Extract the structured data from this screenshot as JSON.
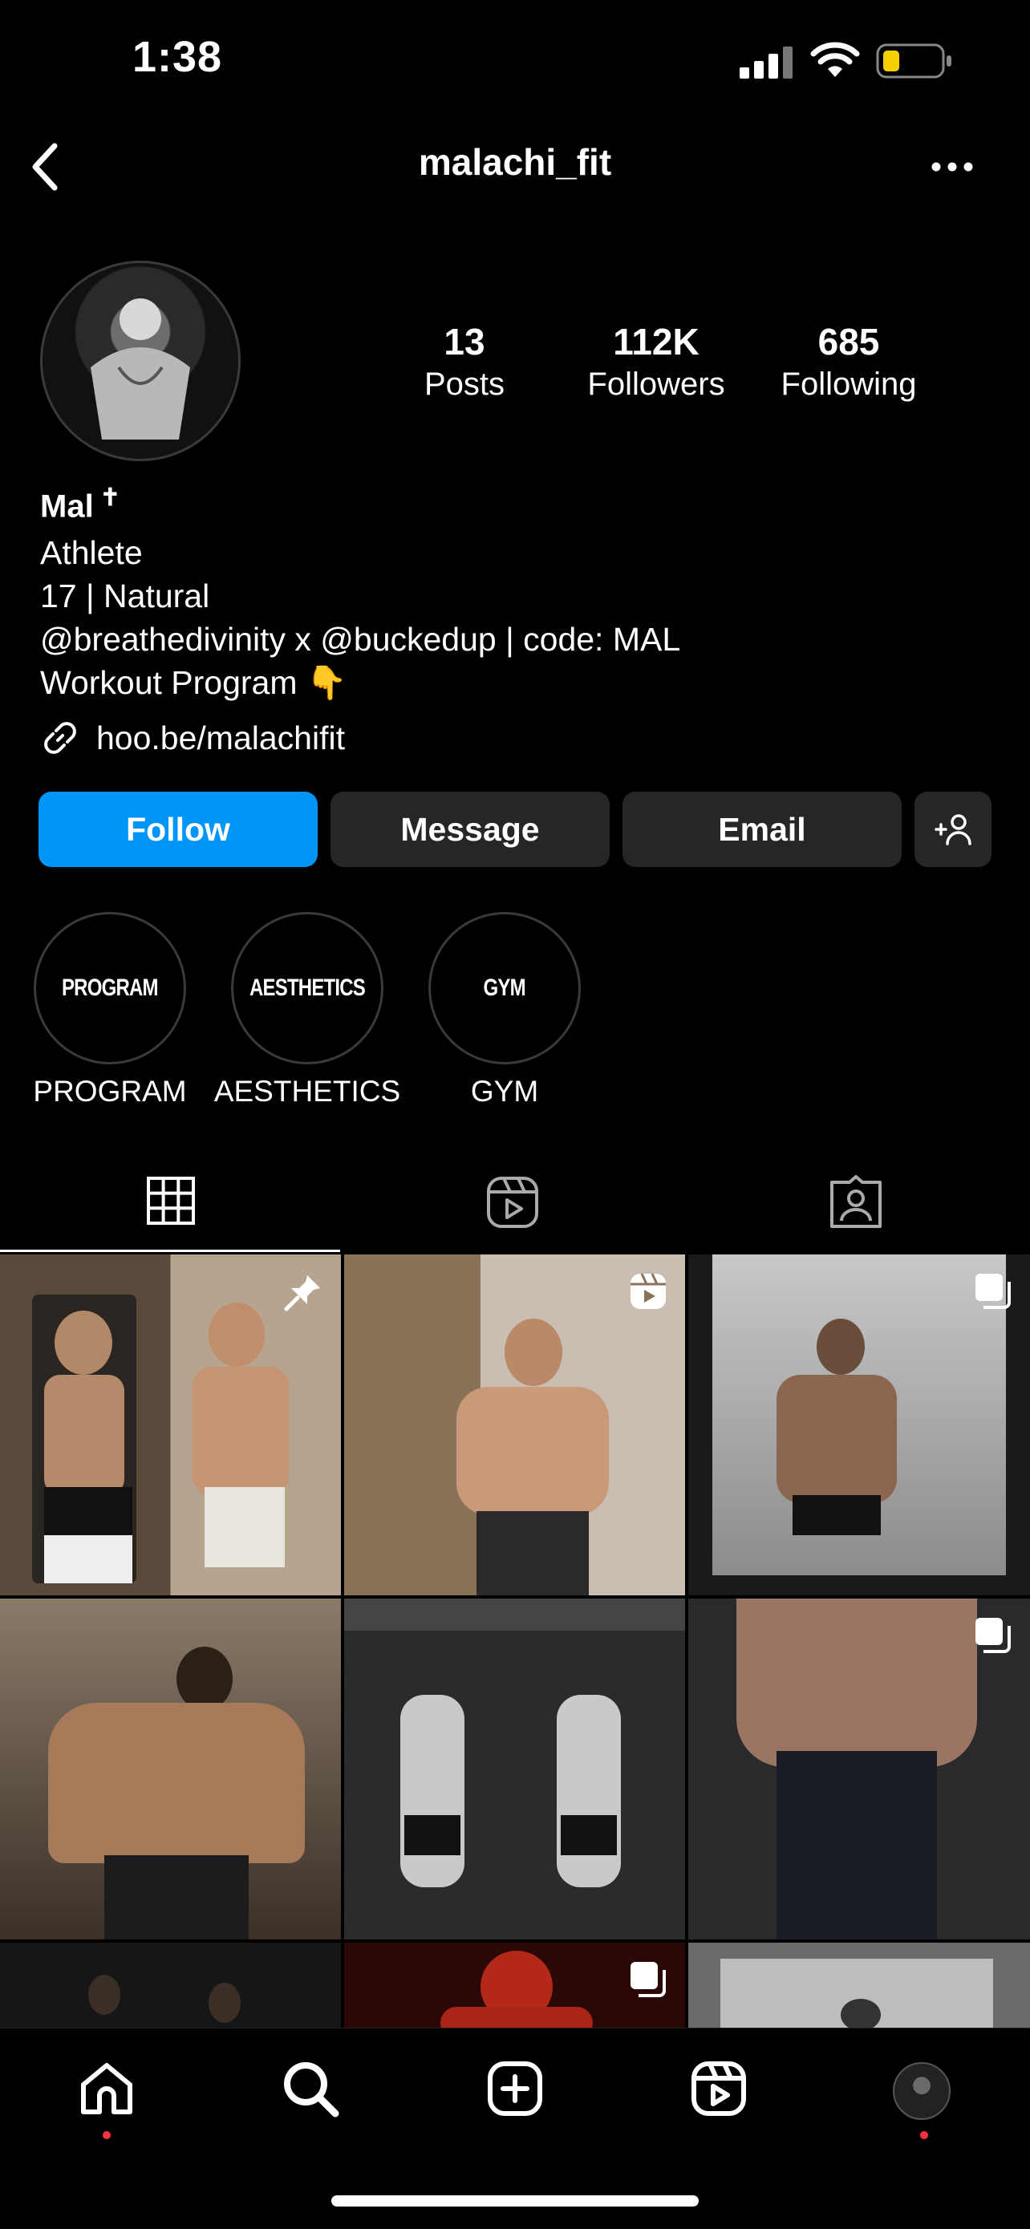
{
  "status_bar": {
    "time": "1:38"
  },
  "header": {
    "username": "malachi_fit"
  },
  "profile": {
    "stats": [
      {
        "value": "13",
        "label": "Posts"
      },
      {
        "value": "112K",
        "label": "Followers"
      },
      {
        "value": "685",
        "label": "Following"
      }
    ],
    "name": "Mal",
    "name_symbol": "✝",
    "bio_lines": [
      "Athlete",
      "17 | Natural",
      "@breathedivinity x @buckedup | code: MAL",
      "Workout Program 👇"
    ],
    "link": "hoo.be/malachifit"
  },
  "actions": {
    "follow": "Follow",
    "message": "Message",
    "email": "Email"
  },
  "highlights": [
    {
      "cover": "PROGRAM",
      "label": "PROGRAM"
    },
    {
      "cover": "AESTHETICS",
      "label": "AESTHETICS"
    },
    {
      "cover": "GYM",
      "label": "GYM"
    }
  ],
  "tabs": [
    "grid-icon",
    "reels-icon",
    "tagged-icon"
  ],
  "grid_posts": [
    {
      "type": "pinned-photo",
      "colors": [
        "#6a5a4a",
        "#c8b09a"
      ]
    },
    {
      "type": "reel",
      "colors": [
        "#8a7a6a",
        "#c9b7a5"
      ]
    },
    {
      "type": "carousel",
      "colors": [
        "#3a3a3a",
        "#9a9a9a"
      ]
    },
    {
      "type": "photo",
      "colors": [
        "#7a6a5a",
        "#3a3028"
      ]
    },
    {
      "type": "photo",
      "colors": [
        "#2a2a2a",
        "#8a8a8a"
      ]
    },
    {
      "type": "carousel",
      "colors": [
        "#4a4a4a",
        "#1e2028"
      ]
    },
    {
      "type": "photo",
      "colors": [
        "#1a1a1a",
        "#3a3a3a"
      ]
    },
    {
      "type": "carousel",
      "colors": [
        "#3a0a0a",
        "#b42818"
      ]
    },
    {
      "type": "photo",
      "colors": [
        "#5a5a5a",
        "#aaaaaa"
      ]
    }
  ],
  "colors": {
    "accent": "#0095f6",
    "button_bg": "#262626",
    "notification": "#ff3040"
  }
}
